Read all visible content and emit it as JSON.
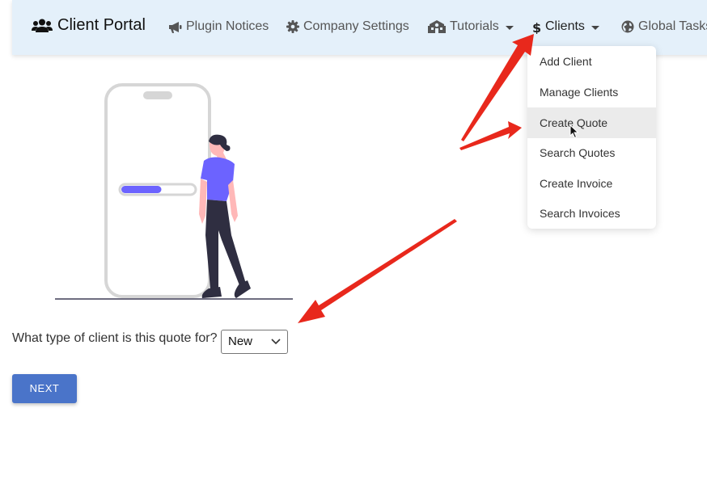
{
  "navbar": {
    "brand": "Client Portal",
    "items": [
      {
        "label": "Plugin Notices",
        "icon": "megaphone-icon"
      },
      {
        "label": "Company Settings",
        "icon": "gear-icon"
      },
      {
        "label": "Tutorials",
        "icon": "school-icon"
      },
      {
        "label": "Clients",
        "icon": "dollar-icon"
      },
      {
        "label": "Global Tasks",
        "icon": "globe-icon"
      }
    ]
  },
  "clients_menu": {
    "items": [
      "Add Client",
      "Manage Clients",
      "Create Quote",
      "Search Quotes",
      "Create Invoice",
      "Search Invoices"
    ],
    "hovered": "Create Quote"
  },
  "form": {
    "question": "What type of client is this quote for?",
    "select_value": "New",
    "next_label": "NEXT"
  },
  "colors": {
    "navbar_bg": "#e4f0fa",
    "accent_purple": "#6c63ff",
    "button_blue": "#4a74c9",
    "arrow_red": "#e8281c"
  },
  "illustration": {
    "progress": 0.55
  }
}
